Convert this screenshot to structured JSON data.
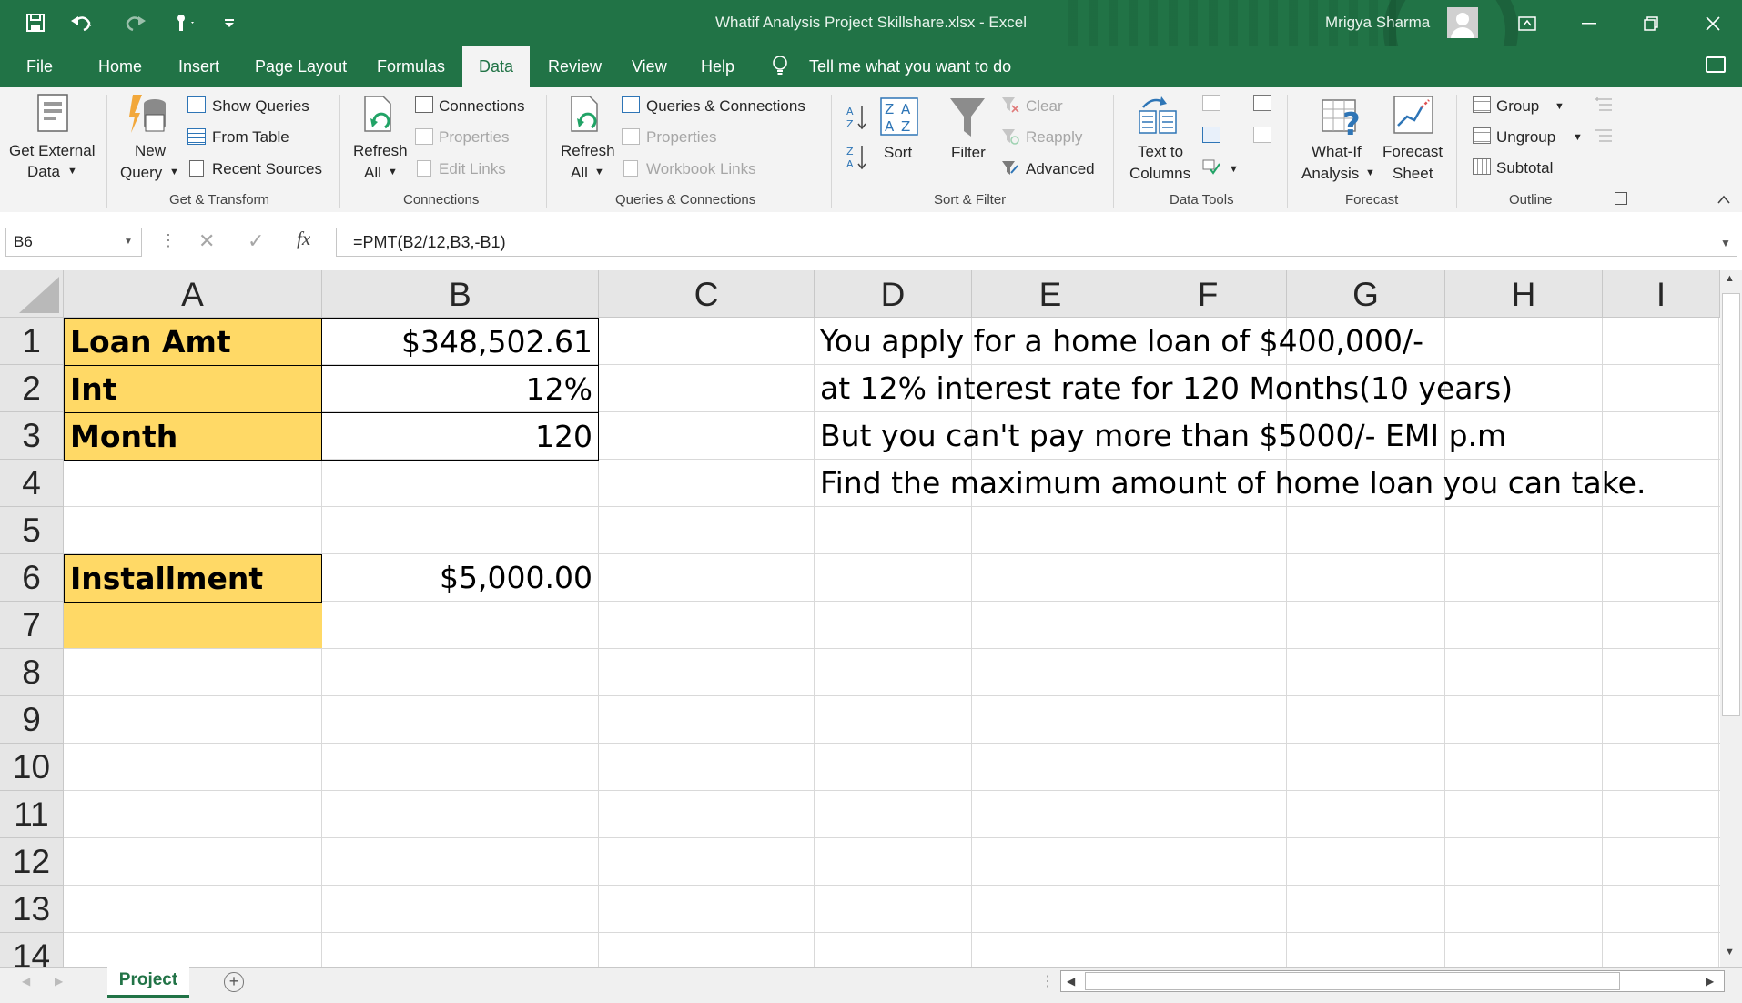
{
  "title_bar": {
    "document_title": "Whatif Analysis Project Skillshare.xlsx  -  Excel",
    "user_name": "Mrigya Sharma",
    "qat_icons": [
      "save-icon",
      "undo-icon",
      "redo-icon",
      "touch-mode-icon",
      "customize-qat-icon"
    ],
    "window_buttons": [
      "ribbon-display-icon",
      "minimize-icon",
      "restore-icon",
      "close-icon"
    ]
  },
  "tabs": [
    "File",
    "Home",
    "Insert",
    "Page Layout",
    "Formulas",
    "Data",
    "Review",
    "View",
    "Help"
  ],
  "active_tab": "Data",
  "tell_me": "Tell me what you want to do",
  "ribbon": {
    "get_transform": {
      "get_external_data": "Get External",
      "get_external_data2": "Data",
      "new_query": "New",
      "new_query2": "Query",
      "show_queries": "Show Queries",
      "from_table": "From Table",
      "recent_sources": "Recent Sources",
      "group_label": "Get & Transform"
    },
    "connections": {
      "refresh_all": "Refresh",
      "refresh_all2": "All",
      "connections": "Connections",
      "properties": "Properties",
      "edit_links": "Edit Links",
      "group_label": "Connections"
    },
    "queries": {
      "refresh_all": "Refresh",
      "refresh_all2": "All",
      "queries_connections": "Queries & Connections",
      "properties": "Properties",
      "workbook_links": "Workbook Links",
      "group_label": "Queries & Connections"
    },
    "sort_filter": {
      "sort": "Sort",
      "filter": "Filter",
      "clear": "Clear",
      "reapply": "Reapply",
      "advanced": "Advanced",
      "group_label": "Sort & Filter"
    },
    "data_tools": {
      "text_to_columns": "Text to",
      "text_to_columns2": "Columns",
      "group_label": "Data Tools"
    },
    "forecast": {
      "what_if": "What-If",
      "what_if2": "Analysis",
      "forecast_sheet": "Forecast",
      "forecast_sheet2": "Sheet",
      "group_label": "Forecast"
    },
    "outline": {
      "group": "Group",
      "ungroup": "Ungroup",
      "subtotal": "Subtotal",
      "group_label": "Outline"
    }
  },
  "formula_bar": {
    "name_box": "B6",
    "fx": "fx",
    "formula": "=PMT(B2/12,B3,-B1)"
  },
  "columns": [
    "A",
    "B",
    "C",
    "D",
    "E",
    "F",
    "G",
    "H",
    "I"
  ],
  "rows": [
    "1",
    "2",
    "3",
    "4",
    "5",
    "6",
    "7",
    "8",
    "9",
    "10",
    "11",
    "12",
    "13",
    "14"
  ],
  "cells": {
    "A1": "Loan Amt",
    "B1": "$348,502.61",
    "A2": "Int",
    "B2": "12%",
    "A3": "Month",
    "B3": "120",
    "A6": "Installment",
    "B6": "$5,000.00",
    "D1": "You apply for a home loan of $400,000/-",
    "D2": "at 12% interest rate for 120 Months(10 years)",
    "D3": "But you can't pay more than $5000/- EMI p.m",
    "D4": "Find the maximum amount of home loan you can take."
  },
  "sheets": [
    "Project"
  ],
  "active_sheet": "Project",
  "colors": {
    "excel_green": "#217346",
    "label_fill": "#ffd966"
  }
}
